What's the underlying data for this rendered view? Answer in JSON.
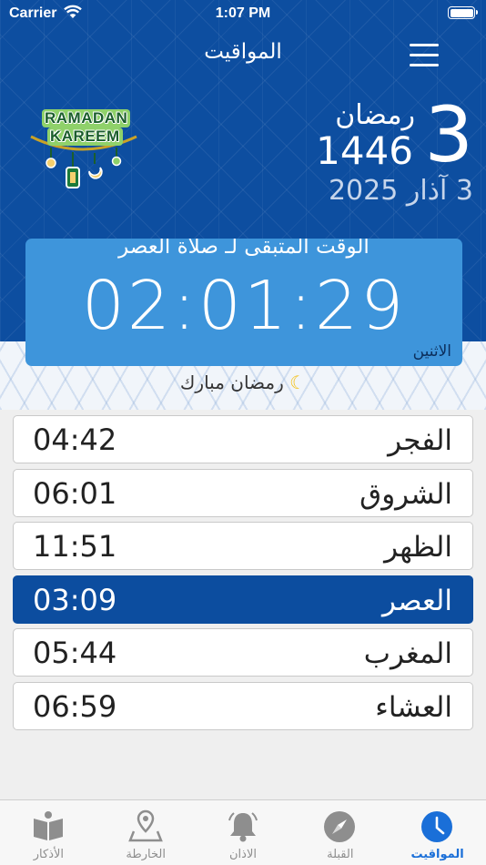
{
  "status_bar": {
    "carrier": "Carrier",
    "time": "1:07 PM"
  },
  "nav": {
    "title": "المواقيت"
  },
  "date": {
    "hijri_day": "3",
    "hijri_month": "رمضان",
    "hijri_year": "1446",
    "gregorian": "3 آذار 2025"
  },
  "logo": {
    "line1": "RAMADAN",
    "line2": "KAREEM"
  },
  "countdown": {
    "label": "الوقت المتبقى لـ صلاة العصر",
    "value": "02:01:29",
    "weekday": "الاثنين"
  },
  "greeting": "رمضان مبارك",
  "prayers": [
    {
      "name": "الفجر",
      "time": "04:42",
      "active": false
    },
    {
      "name": "الشروق",
      "time": "06:01",
      "active": false
    },
    {
      "name": "الظهر",
      "time": "11:51",
      "active": false
    },
    {
      "name": "العصر",
      "time": "03:09",
      "active": true
    },
    {
      "name": "المغرب",
      "time": "05:44",
      "active": false
    },
    {
      "name": "العشاء",
      "time": "06:59",
      "active": false
    }
  ],
  "tabs": [
    {
      "label": "الأذكار",
      "icon": "book-icon"
    },
    {
      "label": "الخارطة",
      "icon": "map-pin-icon"
    },
    {
      "label": "الاذان",
      "icon": "bell-icon"
    },
    {
      "label": "القبلة",
      "icon": "compass-icon"
    },
    {
      "label": "المواقيت",
      "icon": "clock-icon"
    }
  ],
  "colors": {
    "primary": "#0d4ea0",
    "card": "#3e95db",
    "active_row": "#0c4d9f",
    "active_tab": "#1a6fd8",
    "inactive_tab": "#8e8e8e"
  }
}
